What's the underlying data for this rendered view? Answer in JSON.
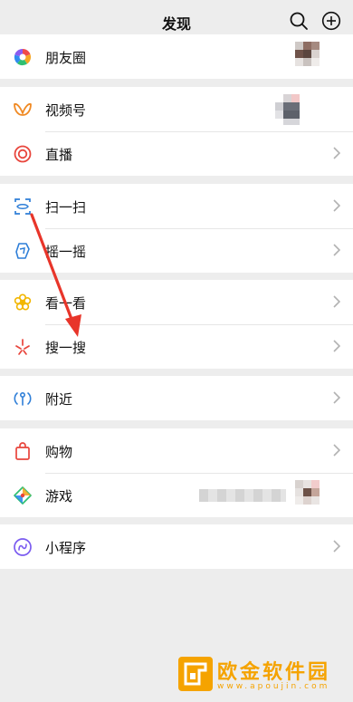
{
  "header": {
    "title": "发现",
    "search_icon": "search-icon",
    "add_icon": "plus-circle-icon"
  },
  "groups": [
    {
      "items": [
        {
          "label": "朋友圈",
          "icon": "moments-aperture-icon",
          "has_thumb": true
        }
      ]
    },
    {
      "items": [
        {
          "label": "视频号",
          "icon": "channels-butterfly-icon",
          "has_thumb": true
        },
        {
          "label": "直播",
          "icon": "live-ring-icon"
        }
      ]
    },
    {
      "items": [
        {
          "label": "扫一扫",
          "icon": "scan-icon"
        },
        {
          "label": "摇一摇",
          "icon": "shake-icon"
        }
      ]
    },
    {
      "items": [
        {
          "label": "看一看",
          "icon": "top-stories-flower-icon"
        },
        {
          "label": "搜一搜",
          "icon": "search-sparkle-icon"
        }
      ]
    },
    {
      "items": [
        {
          "label": "附近",
          "icon": "nearby-icon"
        }
      ]
    },
    {
      "items": [
        {
          "label": "购物",
          "icon": "shopping-bag-icon"
        },
        {
          "label": "游戏",
          "icon": "games-diamond-icon",
          "has_thumb": true
        }
      ]
    },
    {
      "items": [
        {
          "label": "小程序",
          "icon": "mini-programs-icon"
        }
      ]
    }
  ],
  "annotation": {
    "color": "#e8352a"
  },
  "watermark": {
    "title": "欧金软件园",
    "subtitle": "www.apoujin.com",
    "color": "#f5a300"
  }
}
